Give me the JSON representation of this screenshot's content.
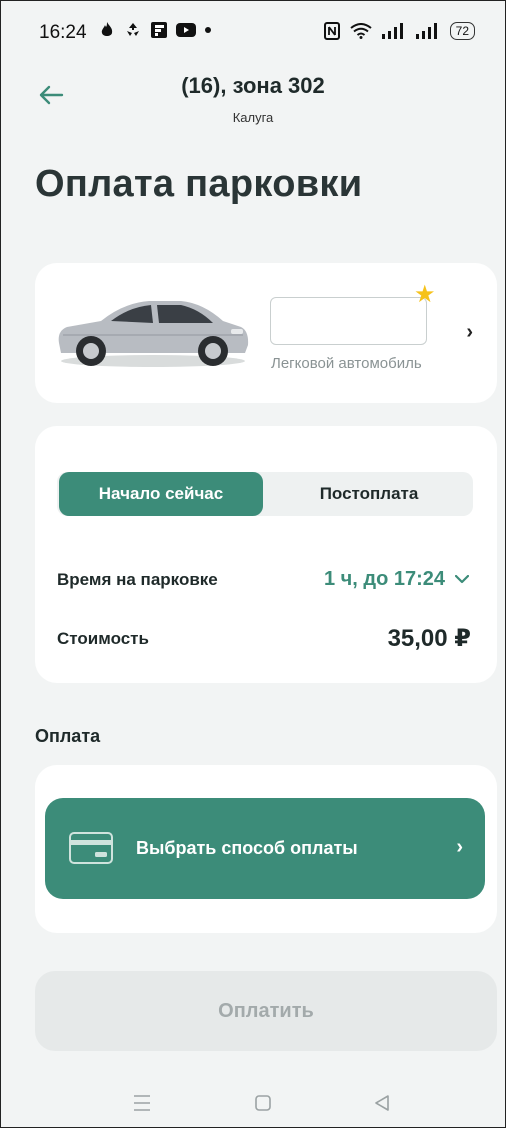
{
  "status_bar": {
    "time": "16:24",
    "left_icons": [
      "flame-icon",
      "recycle-icon",
      "flipboard-icon",
      "youtube-icon",
      "dot-icon"
    ],
    "right_icons": [
      "nfc-icon",
      "wifi-icon",
      "signal-icon",
      "signal-icon"
    ],
    "battery": "72"
  },
  "header": {
    "title": "(16), зона 302",
    "subtitle": "Калуга",
    "back_icon": "arrow-left-icon"
  },
  "page_title": "Оплата парковки",
  "vehicle": {
    "plate": "",
    "type": "Легковой автомобиль",
    "favorite_icon": "star-icon"
  },
  "time_card": {
    "tabs": [
      {
        "label": "Начало сейчас",
        "active": true
      },
      {
        "label": "Постоплата",
        "active": false
      }
    ],
    "duration_label": "Время на парковке",
    "duration_value": "1 ч, до 17:24",
    "cost_label": "Стоимость",
    "cost_value": "35,00 ₽"
  },
  "payment": {
    "section_label": "Оплата",
    "method_button_label": "Выбрать способ оплаты",
    "pay_button_label": "Оплатить"
  },
  "colors": {
    "accent": "#3c8c79",
    "star": "#f6c21a",
    "background": "#f2f4f4",
    "disabled_button": "#e6e9e9"
  }
}
